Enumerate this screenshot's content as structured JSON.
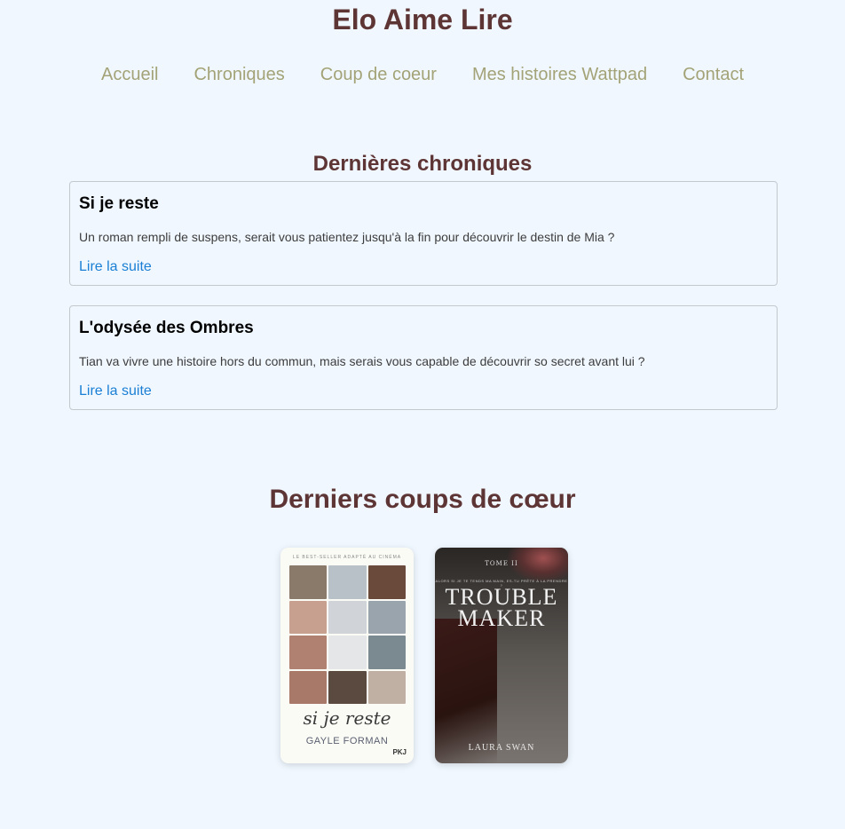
{
  "site": {
    "title": "Elo Aime Lire"
  },
  "nav": {
    "items": [
      {
        "label": "Accueil"
      },
      {
        "label": "Chroniques"
      },
      {
        "label": "Coup de coeur"
      },
      {
        "label": "Mes histoires Wattpad"
      },
      {
        "label": "Contact"
      }
    ]
  },
  "chroniques": {
    "heading": "Dernières chroniques",
    "items": [
      {
        "title": "Si je reste",
        "excerpt": "Un roman rempli de suspens, serait vous patientez jusqu'à la fin pour découvrir le destin de Mia ?",
        "link": "Lire la suite"
      },
      {
        "title": "L'odysée des Ombres",
        "excerpt": "Tian va vivre une histoire hors du commun, mais serais vous capable de découvrir so secret avant lui ?",
        "link": "Lire la suite"
      }
    ]
  },
  "coups_de_coeur": {
    "heading": "Derniers coups de cœur",
    "covers": [
      {
        "top_banner": "LE BEST-SELLER ADAPTÉ AU CINÉMA",
        "title": "si je reste",
        "author": "GAYLE FORMAN",
        "publisher": "PKJ"
      },
      {
        "tome": "TOME II",
        "tagline": "ALORS SI JE TE TENDS MA MAIN, ES-TU PRÊTE À LA PRENDRE ?",
        "title_line1": "TROUBLE",
        "title_line2": "MAKER",
        "author": "LAURA SWAN"
      }
    ]
  },
  "colors": {
    "background": "#f0f7ff",
    "heading": "#5e3535",
    "nav": "#a3a377",
    "link": "#1a7fd4"
  }
}
